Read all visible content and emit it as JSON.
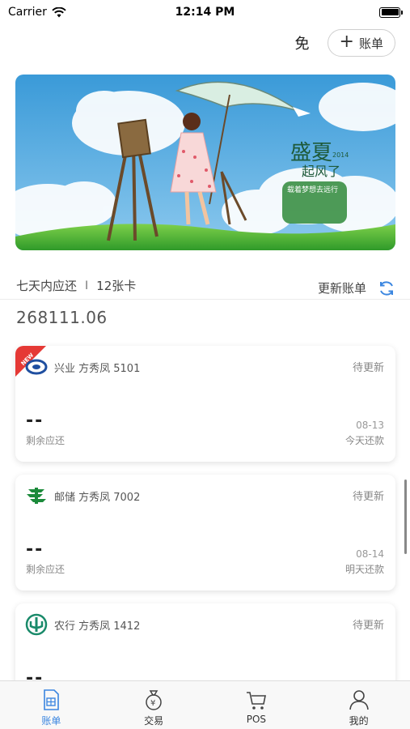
{
  "status_bar": {
    "carrier": "Carrier",
    "time": "12:14 PM"
  },
  "top_actions": {
    "mian": "免",
    "bill_plus": "+",
    "bill_label": "账单"
  },
  "banner": {
    "title_1": "盛夏",
    "title_2": "起风了",
    "year": "2014",
    "subtitle": "载着梦想去远行"
  },
  "summary": {
    "seven_days": "七天内应还",
    "separator": "I",
    "card_count": "12张卡",
    "update_label": "更新账单"
  },
  "total_amount": "268111.06",
  "cards": [
    {
      "bank": "兴业 方秀凤 5101",
      "status": "待更新",
      "amount": "--",
      "remain_label": "剩余应还",
      "date": "08-13",
      "due": "今天还款",
      "badge": "NEW",
      "logo": "cib-logo-icon"
    },
    {
      "bank": "邮储 方秀凤 7002",
      "status": "待更新",
      "amount": "--",
      "remain_label": "剩余应还",
      "date": "08-14",
      "due": "明天还款",
      "logo": "psbc-logo-icon"
    },
    {
      "bank": "农行 方秀凤 1412",
      "status": "待更新",
      "amount": "--",
      "logo": "abc-logo-icon"
    }
  ],
  "tabs": [
    {
      "label": "账单",
      "icon": "bill-doc-icon",
      "active": true
    },
    {
      "label": "交易",
      "icon": "money-bag-icon",
      "active": false
    },
    {
      "label": "POS",
      "icon": "cart-icon",
      "active": false
    },
    {
      "label": "我的",
      "icon": "person-icon",
      "active": false
    }
  ],
  "colors": {
    "accent": "#3b86e0",
    "new_badge": "#e53935",
    "psbc_green": "#1b8a3a",
    "cib_blue": "#1f4fa0",
    "abc_green": "#1a8a6a"
  }
}
